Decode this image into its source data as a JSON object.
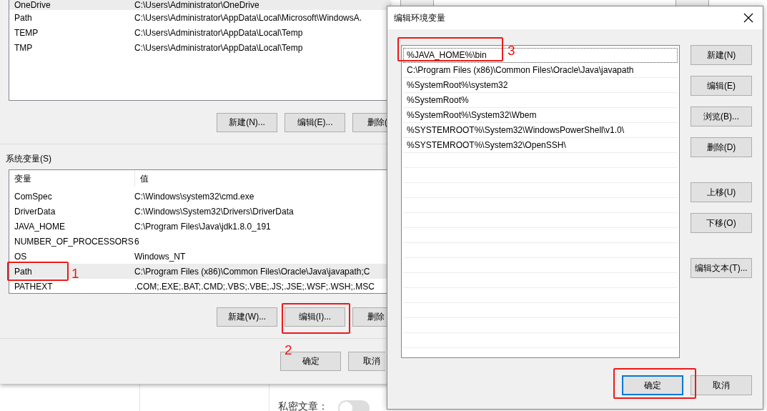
{
  "env_window": {
    "user_variables": {
      "rows": [
        {
          "name": "OneDrive",
          "value": "C:\\Users\\Administrator\\OneDrive",
          "selected": true
        },
        {
          "name": "Path",
          "value": "C:\\Users\\Administrator\\AppData\\Local\\Microsoft\\WindowsA.",
          "selected": false
        },
        {
          "name": "TEMP",
          "value": "C:\\Users\\Administrator\\AppData\\Local\\Temp",
          "selected": false
        },
        {
          "name": "TMP",
          "value": "C:\\Users\\Administrator\\AppData\\Local\\Temp",
          "selected": false
        }
      ],
      "buttons": [
        "新建(N)...",
        "编辑(E)...",
        "删除("
      ]
    },
    "system_variables": {
      "label": "系统变量(S)",
      "columns": [
        "变量",
        "值"
      ],
      "rows": [
        {
          "name": "ComSpec",
          "value": "C:\\Windows\\system32\\cmd.exe",
          "selected": false
        },
        {
          "name": "DriverData",
          "value": "C:\\Windows\\System32\\Drivers\\DriverData",
          "selected": false
        },
        {
          "name": "JAVA_HOME",
          "value": "C:\\Program Files\\Java\\jdk1.8.0_191",
          "selected": false
        },
        {
          "name": "NUMBER_OF_PROCESSORS",
          "value": "6",
          "selected": false
        },
        {
          "name": "OS",
          "value": "Windows_NT",
          "selected": false
        },
        {
          "name": "Path",
          "value": "C:\\Program Files (x86)\\Common Files\\Oracle\\Java\\javapath;C",
          "selected": true
        },
        {
          "name": "PATHEXT",
          "value": ".COM;.EXE;.BAT;.CMD;.VBS;.VBE;.JS;.JSE;.WSF;.WSH;.MSC",
          "selected": false
        }
      ],
      "buttons": [
        "新建(W)...",
        "编辑(I)...",
        "删除"
      ]
    },
    "footer_buttons": [
      "确定",
      "取消"
    ]
  },
  "page_below": {
    "label": "私密文章：",
    "toggle_on": false
  },
  "edit_dialog": {
    "title": "编辑环境变量",
    "entries": [
      {
        "text": "%JAVA_HOME%\\bin",
        "selected": true
      },
      {
        "text": "C:\\Program Files (x86)\\Common Files\\Oracle\\Java\\javapath",
        "selected": false
      },
      {
        "text": "%SystemRoot%\\system32",
        "selected": false
      },
      {
        "text": "%SystemRoot%",
        "selected": false
      },
      {
        "text": "%SystemRoot%\\System32\\Wbem",
        "selected": false
      },
      {
        "text": "%SYSTEMROOT%\\System32\\WindowsPowerShell\\v1.0\\",
        "selected": false
      },
      {
        "text": "%SYSTEMROOT%\\System32\\OpenSSH\\",
        "selected": false
      }
    ],
    "side_button_groups": [
      [
        "新建(N)",
        "编辑(E)",
        "浏览(B)...",
        "删除(D)"
      ],
      [
        "上移(U)",
        "下移(O)"
      ],
      [
        "编辑文本(T)..."
      ]
    ],
    "footer_buttons": [
      {
        "label": "确定",
        "default": true
      },
      {
        "label": "取消",
        "default": false
      }
    ]
  },
  "annotations": [
    "1",
    "2",
    "3"
  ]
}
